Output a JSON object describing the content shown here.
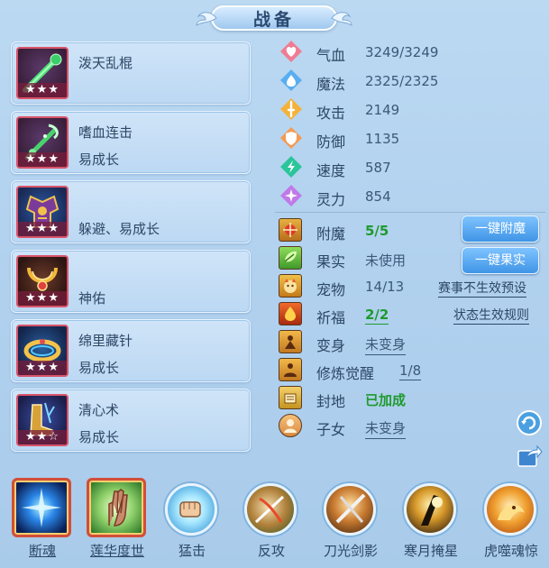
{
  "title": "战备",
  "items": [
    {
      "line1": "泼天乱棍",
      "line2": "",
      "stars": "★★★",
      "icon": "staff-icon"
    },
    {
      "line1": "嗜血连击",
      "line2": "易成长",
      "stars": "★★★",
      "icon": "staff-icon"
    },
    {
      "line1": "",
      "line2": "躲避、易成长",
      "stars": "★★★",
      "icon": "armor-icon"
    },
    {
      "line1": "",
      "line2": "神佑",
      "stars": "★★★",
      "icon": "necklace-icon"
    },
    {
      "line1": "绵里藏针",
      "line2": "易成长",
      "stars": "★★★",
      "icon": "bracelet-icon"
    },
    {
      "line1": "清心术",
      "line2": "易成长",
      "stars": "★★☆",
      "icon": "boots-icon"
    }
  ],
  "stats": [
    {
      "label": "气血",
      "value": "3249/3249",
      "icon": "heart-icon",
      "color": "#e85a7a"
    },
    {
      "label": "魔法",
      "value": "2325/2325",
      "icon": "mana-icon",
      "color": "#4aa0ea"
    },
    {
      "label": "攻击",
      "value": "2149",
      "icon": "attack-icon",
      "color": "#f0a02a"
    },
    {
      "label": "防御",
      "value": "1135",
      "icon": "defense-icon",
      "color": "#f08a3a"
    },
    {
      "label": "速度",
      "value": "587",
      "icon": "speed-icon",
      "color": "#27b98a"
    },
    {
      "label": "灵力",
      "value": "854",
      "icon": "spirit-icon",
      "color": "#b06ae0"
    }
  ],
  "attrs": [
    {
      "label": "附魔",
      "value": "5/5",
      "style": "green"
    },
    {
      "label": "果实",
      "value": "未使用",
      "style": "plain"
    },
    {
      "label": "宠物",
      "value": "14/13",
      "style": "plain"
    },
    {
      "label": "祈福",
      "value": "2/2",
      "style": "green-ul"
    },
    {
      "label": "变身",
      "value": "未变身",
      "style": "ul"
    },
    {
      "label": "修炼觉醒",
      "value": "1/8",
      "style": "ul"
    },
    {
      "label": "封地",
      "value": "已加成",
      "style": "green"
    },
    {
      "label": "子女",
      "value": "未变身",
      "style": "ul"
    }
  ],
  "buttons": {
    "enchant": "一键附魔",
    "fruit": "一键果实"
  },
  "links": {
    "preset": "赛事不生效预设",
    "rules": "状态生效规则"
  },
  "skills": [
    {
      "name": "断魂",
      "shape": "square",
      "icon": "orb-icon"
    },
    {
      "name": "莲华度世",
      "shape": "square",
      "icon": "palm-icon"
    },
    {
      "name": "猛击",
      "shape": "round",
      "icon": "fist-icon"
    },
    {
      "name": "反攻",
      "shape": "round",
      "icon": "counter-icon"
    },
    {
      "name": "刀光剑影",
      "shape": "round",
      "icon": "blade-icon"
    },
    {
      "name": "寒月掩星",
      "shape": "round",
      "icon": "moon-icon"
    },
    {
      "name": "虎噬魂惊",
      "shape": "round",
      "icon": "tiger-icon"
    }
  ]
}
